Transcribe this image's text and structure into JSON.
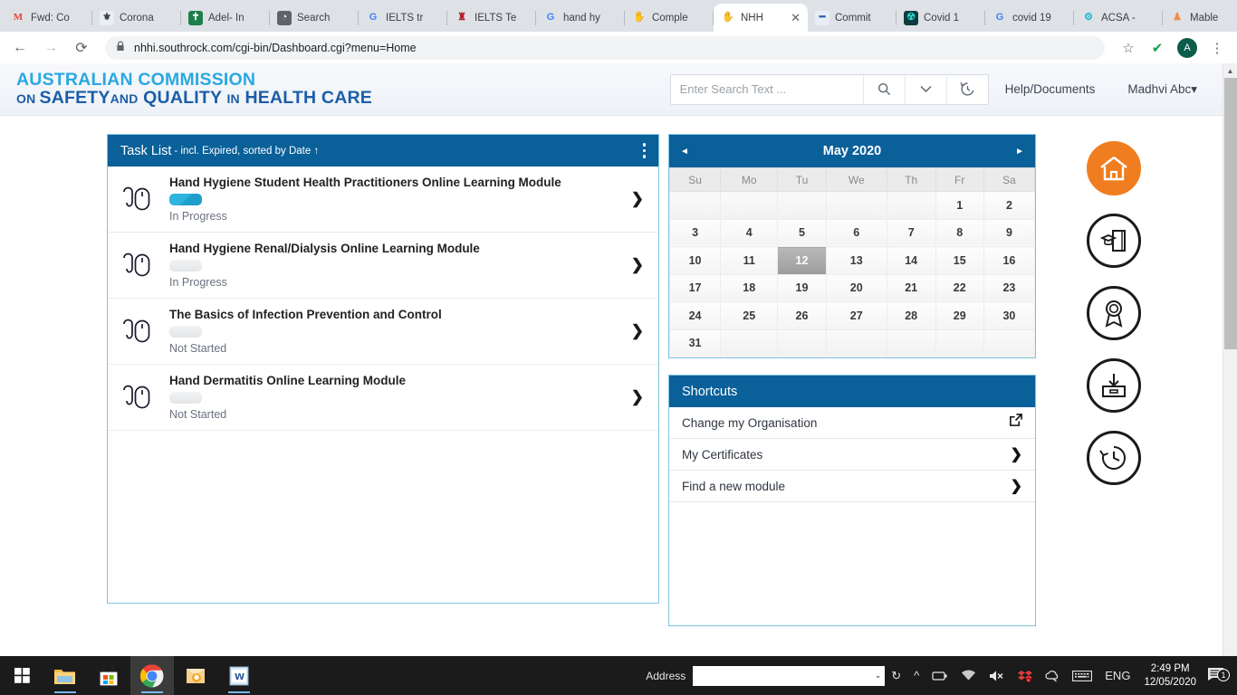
{
  "browser": {
    "tabs": [
      {
        "label": "Fwd: Co",
        "icon": "gmail-icon",
        "fav_class": "fav-gmail",
        "glyph": "M",
        "active": false
      },
      {
        "label": "Corona",
        "icon": "coronavirus-icon",
        "fav_class": "fav-corona",
        "glyph": "⚜",
        "active": false
      },
      {
        "label": "Adel- In",
        "icon": "adelaide-icon",
        "fav_class": "fav-adel",
        "glyph": "✝",
        "active": false
      },
      {
        "label": "Search",
        "icon": "search-globe-icon",
        "fav_class": "fav-search",
        "glyph": "◔",
        "active": false
      },
      {
        "label": "IELTS tr",
        "icon": "google-icon",
        "fav_class": "fav-g",
        "glyph": "G",
        "active": false
      },
      {
        "label": "IELTS Te",
        "icon": "ielts-icon",
        "fav_class": "fav-ielts",
        "glyph": "♜",
        "active": false
      },
      {
        "label": "hand hy",
        "icon": "google-icon",
        "fav_class": "fav-g",
        "glyph": "G",
        "active": false
      },
      {
        "label": "Comple",
        "icon": "hand-hygiene-icon",
        "fav_class": "fav-hand",
        "glyph": "✋",
        "active": false
      },
      {
        "label": "NHH",
        "icon": "nhhi-icon",
        "fav_class": "fav-nhhi",
        "glyph": "✋",
        "active": true
      },
      {
        "label": "Commit",
        "icon": "commit-icon",
        "fav_class": "fav-commit",
        "glyph": "━",
        "active": false
      },
      {
        "label": "Covid 1",
        "icon": "covid-icon",
        "fav_class": "fav-covid",
        "glyph": "☢",
        "active": false
      },
      {
        "label": "covid 19",
        "icon": "google-icon",
        "fav_class": "fav-g",
        "glyph": "G",
        "active": false
      },
      {
        "label": "ACSA -",
        "icon": "acsa-icon",
        "fav_class": "fav-acsa",
        "glyph": "⚙",
        "active": false
      },
      {
        "label": "Mable",
        "icon": "mable-icon",
        "fav_class": "fav-mable",
        "glyph": "♟",
        "active": false
      }
    ],
    "new_tab_label": "+",
    "tab_close_label": "✕",
    "window_controls": {
      "minimize": "—",
      "maximize": "❐",
      "close": "✕"
    },
    "back_label": "←",
    "forward_label": "→",
    "reload_label": "⟳",
    "lock_label": "🔒",
    "url": "nhhi.southrock.com/cgi-bin/Dashboard.cgi?menu=Home",
    "bookmark_label": "☆",
    "verified_label": "✔",
    "profile_initial": "A",
    "menu_label": "⋮"
  },
  "page": {
    "logo": {
      "line1": "AUSTRALIAN COMMISSION",
      "line2_a": "ON ",
      "line2_b": "SAFETY",
      "line2_c": "AND",
      "line2_d": " QUALITY ",
      "line2_e": "IN",
      "line2_f": " HEALTH CARE"
    },
    "search": {
      "placeholder": "Enter Search Text ...",
      "value": "",
      "search_icon": "🔍",
      "dropdown_icon": "⌄",
      "history_icon": "↺"
    },
    "help_link": "Help/Documents",
    "user_menu": "Madhvi Abc",
    "user_caret": "▾"
  },
  "task_list": {
    "title": "Task List",
    "subtitle": "- incl. Expired, sorted by Date ↑",
    "menu_icon": "kebab-menu-icon",
    "items": [
      {
        "name": "Hand Hygiene Student Health Practitioners Online Learning Module",
        "status": "In Progress",
        "bar": "prog"
      },
      {
        "name": "Hand Hygiene Renal/Dialysis Online Learning Module",
        "status": "In Progress",
        "bar": "none"
      },
      {
        "name": "The Basics of Infection Prevention and Control",
        "status": "Not Started",
        "bar": "none"
      },
      {
        "name": "Hand Dermatitis Online Learning Module",
        "status": "Not Started",
        "bar": "none"
      }
    ],
    "chevron": "❯"
  },
  "calendar": {
    "title": "May 2020",
    "prev": "◄",
    "next": "►",
    "weekdays": [
      "Su",
      "Mo",
      "Tu",
      "We",
      "Th",
      "Fr",
      "Sa"
    ],
    "weeks": [
      [
        "",
        "",
        "",
        "",
        "",
        "1",
        "2"
      ],
      [
        "3",
        "4",
        "5",
        "6",
        "7",
        "8",
        "9"
      ],
      [
        "10",
        "11",
        "12",
        "13",
        "14",
        "15",
        "16"
      ],
      [
        "17",
        "18",
        "19",
        "20",
        "21",
        "22",
        "23"
      ],
      [
        "24",
        "25",
        "26",
        "27",
        "28",
        "29",
        "30"
      ],
      [
        "31",
        "",
        "",
        "",
        "",
        "",
        ""
      ]
    ],
    "today": "12"
  },
  "shortcuts": {
    "title": "Shortcuts",
    "items": [
      {
        "label": "Change my Organisation",
        "icon": "external-link-icon",
        "glyph": "↗"
      },
      {
        "label": "My Certificates",
        "icon": "chevron-right-icon",
        "glyph": "❯"
      },
      {
        "label": "Find a new module",
        "icon": "chevron-right-icon",
        "glyph": "❯"
      }
    ]
  },
  "nav_icons": [
    {
      "name": "home-icon",
      "active": true
    },
    {
      "name": "learning-module-icon",
      "active": false
    },
    {
      "name": "certificate-icon",
      "active": false
    },
    {
      "name": "archive-inbox-icon",
      "active": false
    },
    {
      "name": "history-clock-icon",
      "active": false
    }
  ],
  "colors": {
    "panel_header_blue": "#0a6099",
    "logo_cyan": "#2ba8e0",
    "logo_blue": "#1b5ea8",
    "accent_orange": "#f07d1f",
    "progress_cyan": "#2fb4dd"
  },
  "taskbar": {
    "start_icon": "windows-start-icon",
    "apps": [
      {
        "name": "file-explorer-icon"
      },
      {
        "name": "microsoft-store-icon"
      },
      {
        "name": "chrome-icon"
      },
      {
        "name": "outlook-icon"
      },
      {
        "name": "word-icon"
      }
    ],
    "address_label": "Address",
    "address_value": "",
    "address_caret": "⌄",
    "refresh_icon": "↻",
    "tray": [
      {
        "name": "show-hidden-icons",
        "glyph": "⌃"
      },
      {
        "name": "battery-icon",
        "glyph": "▭"
      },
      {
        "name": "wifi-icon",
        "glyph": "◠"
      },
      {
        "name": "volume-muted-icon",
        "glyph": "🔇"
      },
      {
        "name": "dropbox-icon",
        "glyph": "❖"
      },
      {
        "name": "onedrive-icon",
        "glyph": "☁"
      },
      {
        "name": "keyboard-icon",
        "glyph": "⌨"
      }
    ],
    "language": "ENG",
    "time": "2:49 PM",
    "date": "12/05/2020",
    "notification_count": "1"
  }
}
